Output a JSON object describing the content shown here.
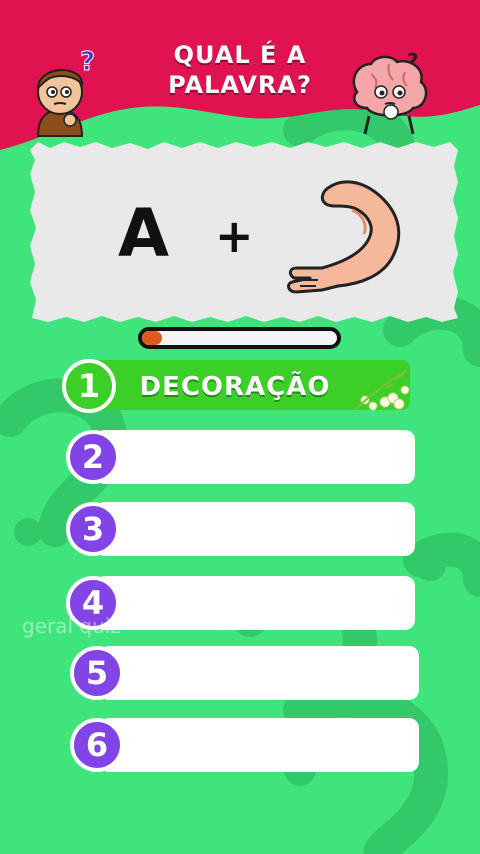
{
  "header": {
    "title_line1": "QUAL É A",
    "title_line2": "PALAVRA?",
    "background_color": "#e0124f"
  },
  "puzzle": {
    "letter": "A",
    "operator": "+",
    "image_icon": "arm-icon"
  },
  "timer": {
    "progress": 0.1,
    "fill_color": "#e05a1f"
  },
  "answers": [
    {
      "number": "1",
      "text": "DECORAÇÃO",
      "revealed": true
    },
    {
      "number": "2",
      "text": "",
      "revealed": false
    },
    {
      "number": "3",
      "text": "",
      "revealed": false
    },
    {
      "number": "4",
      "text": "",
      "revealed": false
    },
    {
      "number": "5",
      "text": "",
      "revealed": false
    },
    {
      "number": "6",
      "text": "",
      "revealed": false
    }
  ],
  "watermark": "geral quiz",
  "colors": {
    "background": "#3fe57c",
    "answer_active": "#3ccf27",
    "number_badge": "#8244e6"
  }
}
